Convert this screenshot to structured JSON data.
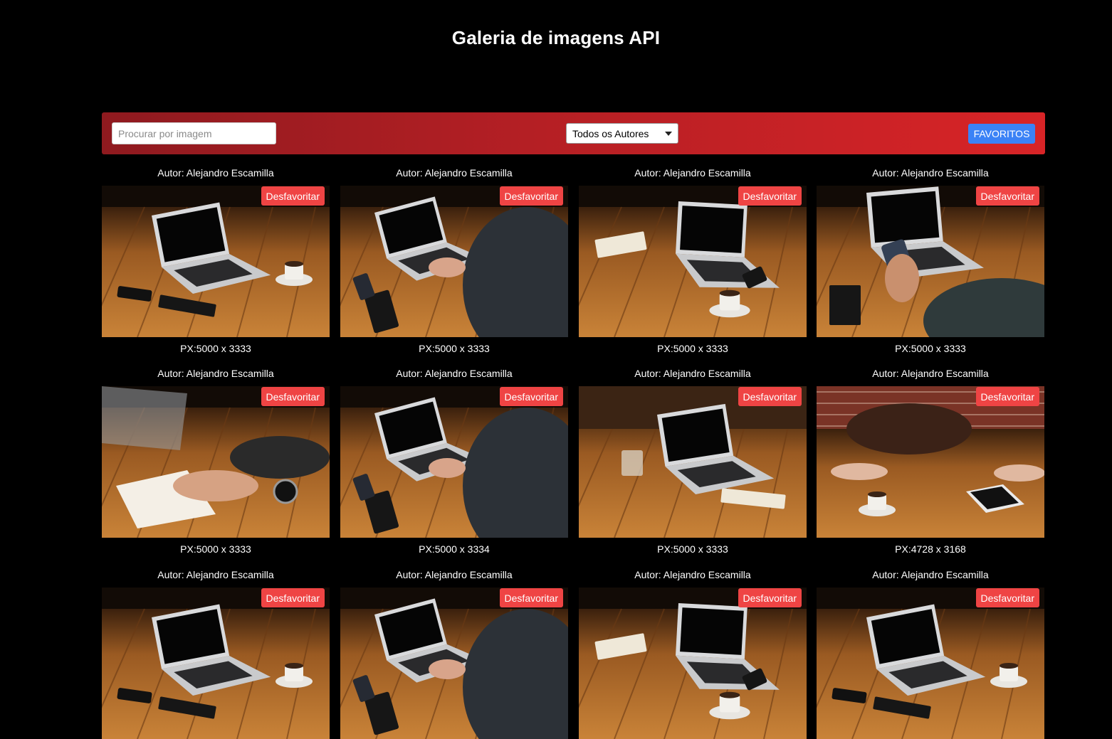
{
  "header": {
    "title": "Galeria de imagens API"
  },
  "toolbar": {
    "search_placeholder": "Procurar por imagem",
    "author_filter_value": "Todos os Autores",
    "favorites_label": "FAVORITOS"
  },
  "colors": {
    "background": "#000000",
    "toolbar_start": "#8f1a1f",
    "toolbar_end": "#d82427",
    "favorites_button": "#3b82f6",
    "unfavorite_button": "#ef4444"
  },
  "cards": [
    {
      "author": "Autor: Alejandro Escamilla",
      "button": "Desfavoritar",
      "dims": "PX:5000 x 3333",
      "scene": "laptop-on-wooden-table"
    },
    {
      "author": "Autor: Alejandro Escamilla",
      "button": "Desfavoritar",
      "dims": "PX:5000 x 3333",
      "scene": "person-typing-on-laptop"
    },
    {
      "author": "Autor: Alejandro Escamilla",
      "button": "Desfavoritar",
      "dims": "PX:5000 x 3333",
      "scene": "laptop-with-coffee-cup"
    },
    {
      "author": "Autor: Alejandro Escamilla",
      "button": "Desfavoritar",
      "dims": "PX:5000 x 3333",
      "scene": "hand-holding-phone"
    },
    {
      "author": "Autor: Alejandro Escamilla",
      "button": "Desfavoritar",
      "dims": "PX:5000 x 3333",
      "scene": "hand-writing-notebook"
    },
    {
      "author": "Autor: Alejandro Escamilla",
      "button": "Desfavoritar",
      "dims": "PX:5000 x 3334",
      "scene": "person-typing-on-laptop"
    },
    {
      "author": "Autor: Alejandro Escamilla",
      "button": "Desfavoritar",
      "dims": "PX:5000 x 3333",
      "scene": "laptop-with-glass"
    },
    {
      "author": "Autor: Alejandro Escamilla",
      "button": "Desfavoritar",
      "dims": "PX:4728 x 3168",
      "scene": "table-with-bag-and-tablet"
    },
    {
      "author": "Autor: Alejandro Escamilla",
      "button": "Desfavoritar",
      "dims": "",
      "scene": "laptop-on-wooden-table"
    },
    {
      "author": "Autor: Alejandro Escamilla",
      "button": "Desfavoritar",
      "dims": "",
      "scene": "person-typing-on-laptop"
    },
    {
      "author": "Autor: Alejandro Escamilla",
      "button": "Desfavoritar",
      "dims": "",
      "scene": "laptop-with-coffee-cup"
    },
    {
      "author": "Autor: Alejandro Escamilla",
      "button": "Desfavoritar",
      "dims": "",
      "scene": "laptop-on-wooden-table"
    }
  ]
}
